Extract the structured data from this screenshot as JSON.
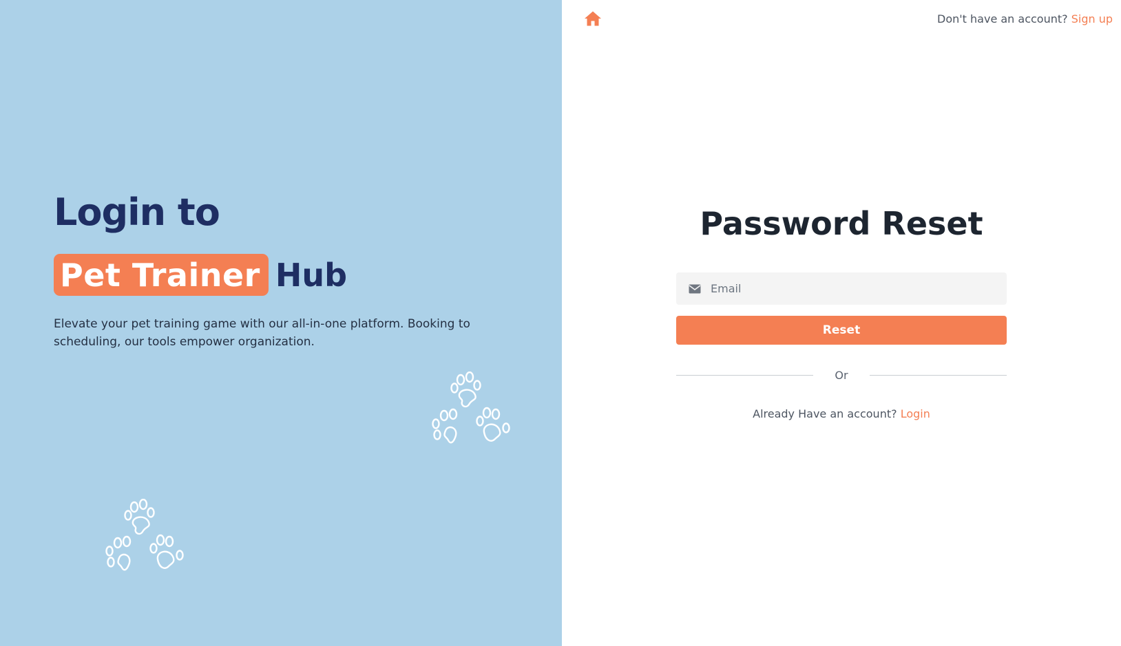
{
  "hero": {
    "title_line1": "Login to",
    "title_highlight": "Pet Trainer",
    "title_suffix": "Hub",
    "description": "Elevate your pet training game with our all-in-one platform. Booking to scheduling, our tools empower organization."
  },
  "header": {
    "home_icon": "home-icon",
    "signup_prompt": "Don't have an account?",
    "signup_link": "Sign up"
  },
  "form": {
    "title": "Password Reset",
    "email_icon": "envelope-icon",
    "email_placeholder": "Email",
    "email_value": "",
    "reset_label": "Reset",
    "divider_text": "Or",
    "login_prompt": "Already Have an account?",
    "login_link": "Login"
  },
  "colors": {
    "left_panel_bg": "#acd1e8",
    "accent": "#f47f53",
    "navy": "#1e2e63",
    "heading": "#1d2530"
  }
}
